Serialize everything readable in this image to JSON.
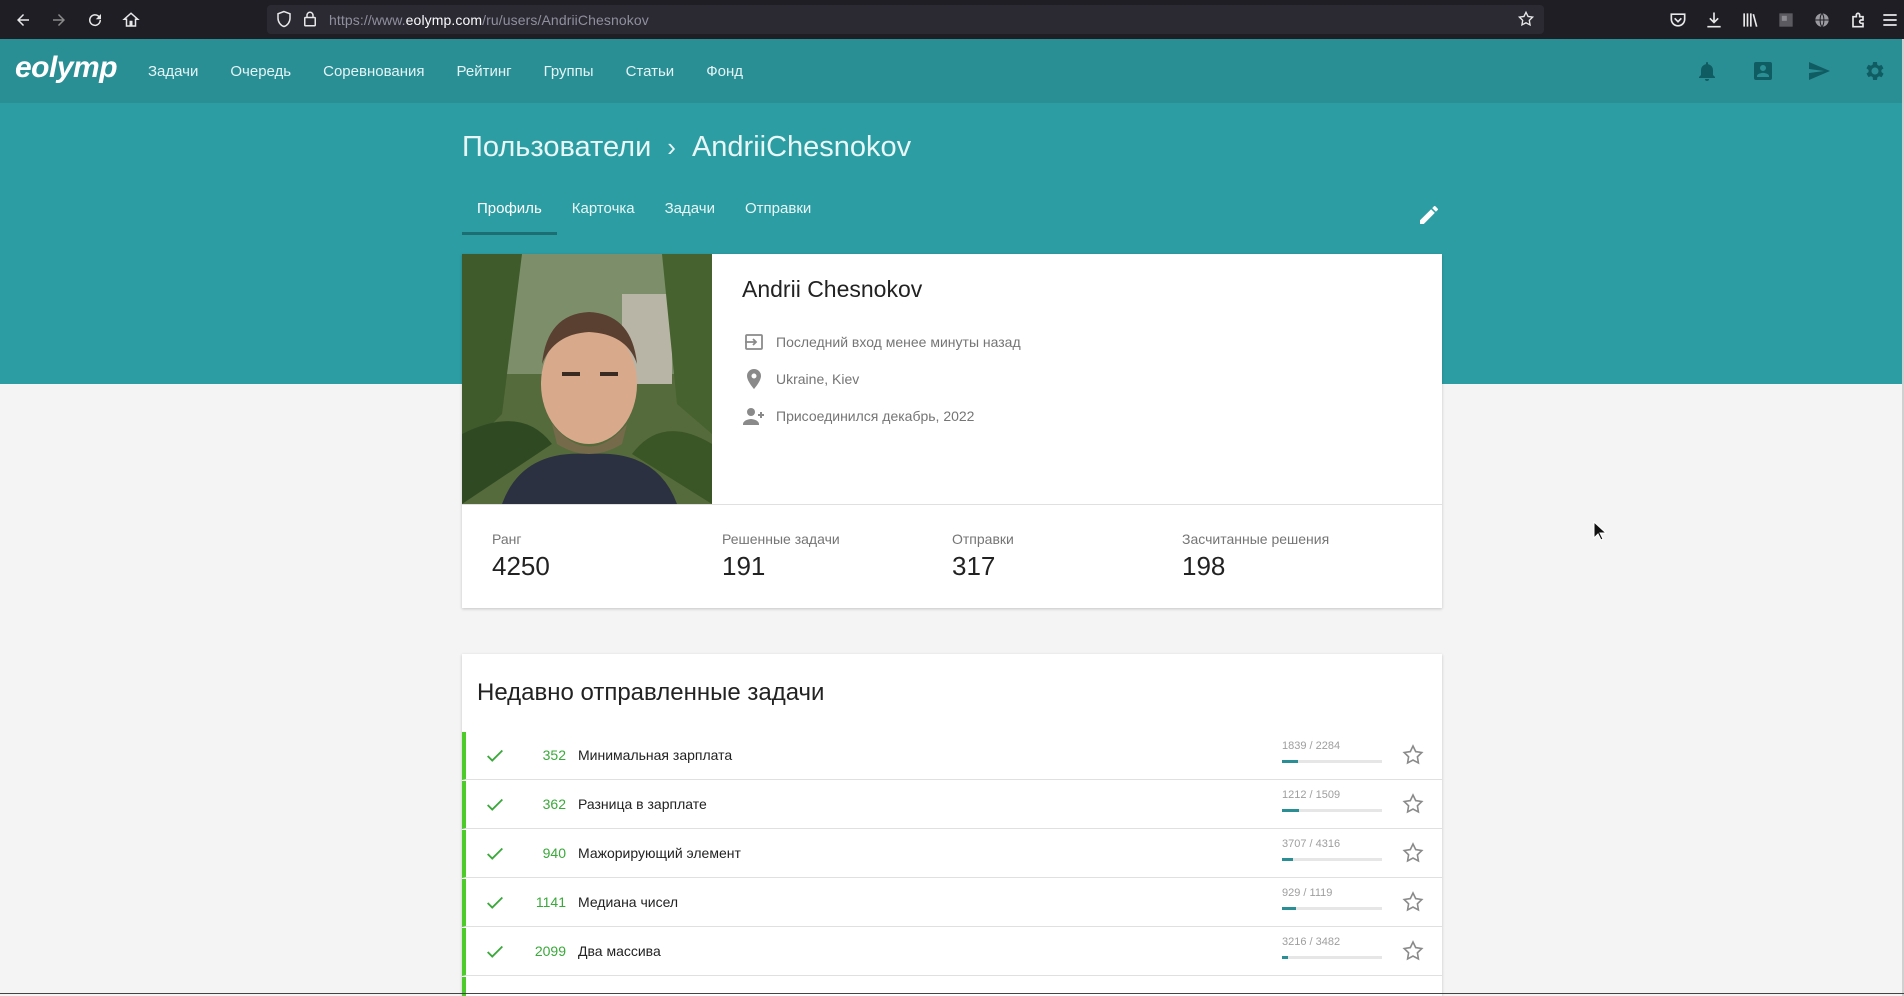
{
  "browser": {
    "url_prefix": "https://www.",
    "url_domain": "eolymp.com",
    "url_path": "/ru/users/AndriiChesnokov"
  },
  "header": {
    "logo": "eolymp",
    "nav": [
      "Задачи",
      "Очередь",
      "Соревнования",
      "Рейтинг",
      "Группы",
      "Статьи",
      "Фонд"
    ]
  },
  "breadcrumb": {
    "parent": "Пользователи",
    "separator": "›",
    "current": "AndriiChesnokov"
  },
  "tabs": [
    {
      "label": "Профиль",
      "active": true
    },
    {
      "label": "Карточка",
      "active": false
    },
    {
      "label": "Задачи",
      "active": false
    },
    {
      "label": "Отправки",
      "active": false
    }
  ],
  "profile": {
    "name": "Andrii Chesnokov",
    "last_login": "Последний вход менее минуты назад",
    "location": "Ukraine, Kiev",
    "joined": "Присоединился декабрь, 2022"
  },
  "stats": [
    {
      "label": "Ранг",
      "value": "4250"
    },
    {
      "label": "Решенные задачи",
      "value": "191"
    },
    {
      "label": "Отправки",
      "value": "317"
    },
    {
      "label": "Засчитанные решения",
      "value": "198"
    }
  ],
  "recent": {
    "title": "Недавно отправленные задачи",
    "tasks": [
      {
        "id": "352",
        "name": "Минимальная зарплата",
        "ratio": "1839 / 2284",
        "progress": 0.16
      },
      {
        "id": "362",
        "name": "Разница в зарплате",
        "ratio": "1212 / 1509",
        "progress": 0.17
      },
      {
        "id": "940",
        "name": "Мажорирующий элемент",
        "ratio": "3707 / 4316",
        "progress": 0.11
      },
      {
        "id": "1141",
        "name": "Медиана чисел",
        "ratio": "929 / 1119",
        "progress": 0.14
      },
      {
        "id": "2099",
        "name": "Два массива",
        "ratio": "3216 / 3482",
        "progress": 0.06
      }
    ]
  },
  "colors": {
    "header": "#2a8f95",
    "hero": "#2c9ea3",
    "accepted": "#4ccb2b"
  }
}
